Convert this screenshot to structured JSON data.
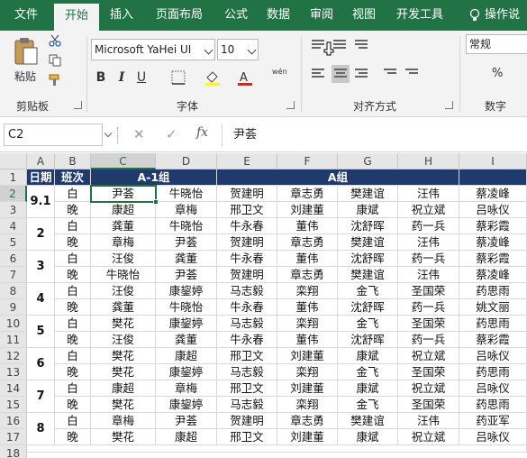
{
  "ribbon_tabs": [
    "文件",
    "开始",
    "插入",
    "页面布局",
    "公式",
    "数据",
    "审阅",
    "视图",
    "开发工具",
    "操作说"
  ],
  "active_tab": "开始",
  "clipboard": {
    "paste_label": "粘贴",
    "group_label": "剪贴板"
  },
  "font": {
    "name": "Microsoft YaHei UI",
    "size": "10",
    "group_label": "字体",
    "bold": "B",
    "italic": "I",
    "underline": "U",
    "phonetic_label": "wén"
  },
  "alignment": {
    "group_label": "对齐方式"
  },
  "number": {
    "format": "常规",
    "group_label": "数字",
    "percent": "%"
  },
  "formula_bar": {
    "name_box": "C2",
    "cancel": "✕",
    "confirm": "✓",
    "fx": "fx",
    "value": "尹荟"
  },
  "columns": [
    "A",
    "B",
    "C",
    "D",
    "E",
    "F",
    "G",
    "H",
    "I"
  ],
  "selected_column": "C",
  "rows": [
    "1",
    "2",
    "3",
    "4",
    "5",
    "6",
    "7",
    "8",
    "9",
    "10",
    "11",
    "12",
    "13",
    "14",
    "15",
    "16",
    "17",
    "18"
  ],
  "selected_row": "2",
  "header": {
    "date": "日期",
    "shift": "班次",
    "group_a1": "A-1组",
    "group_a": "A组"
  },
  "date_labels": [
    "9.1",
    "2",
    "3",
    "4",
    "5",
    "6",
    "7",
    "8"
  ],
  "table_rows": [
    [
      "白",
      "尹荟",
      "牛晓怡",
      "贺建明",
      "章志勇",
      "樊建谊",
      "汪伟",
      "蔡凌峰"
    ],
    [
      "晚",
      "康超",
      "章梅",
      "邢卫文",
      "刘建董",
      "康斌",
      "祝立斌",
      "吕咏仪"
    ],
    [
      "白",
      "龚董",
      "牛晓怡",
      "牛永春",
      "董伟",
      "沈舒晖",
      "药一兵",
      "蔡彩霞"
    ],
    [
      "晚",
      "章梅",
      "尹荟",
      "贺建明",
      "章志勇",
      "樊建谊",
      "汪伟",
      "蔡凌峰"
    ],
    [
      "白",
      "汪俊",
      "龚董",
      "牛永春",
      "董伟",
      "沈舒晖",
      "药一兵",
      "蔡彩霞"
    ],
    [
      "晚",
      "牛晓怡",
      "尹荟",
      "贺建明",
      "章志勇",
      "樊建谊",
      "汪伟",
      "蔡凌峰"
    ],
    [
      "白",
      "汪俊",
      "康鋆婷",
      "马志毅",
      "栾翔",
      "金飞",
      "圣国荣",
      "药思雨"
    ],
    [
      "晚",
      "龚董",
      "牛晓怡",
      "牛永春",
      "董伟",
      "沈舒晖",
      "药一兵",
      "姚文丽"
    ],
    [
      "白",
      "樊花",
      "康鋆婷",
      "马志毅",
      "栾翔",
      "金飞",
      "圣国荣",
      "药思雨"
    ],
    [
      "晚",
      "汪俊",
      "龚董",
      "牛永春",
      "董伟",
      "沈舒晖",
      "药一兵",
      "蔡彩霞"
    ],
    [
      "白",
      "樊花",
      "康超",
      "邢卫文",
      "刘建董",
      "康斌",
      "祝立斌",
      "吕咏仪"
    ],
    [
      "晚",
      "樊花",
      "康鋆婷",
      "马志毅",
      "栾翔",
      "金飞",
      "圣国荣",
      "药思雨"
    ],
    [
      "白",
      "康超",
      "章梅",
      "邢卫文",
      "刘建董",
      "康斌",
      "祝立斌",
      "吕咏仪"
    ],
    [
      "晚",
      "樊花",
      "康鋆婷",
      "马志毅",
      "栾翔",
      "金飞",
      "圣国荣",
      "药思雨"
    ],
    [
      "白",
      "章梅",
      "尹荟",
      "贺建明",
      "章志勇",
      "樊建谊",
      "汪伟",
      "药亚军"
    ],
    [
      "晚",
      "樊花",
      "康超",
      "邢卫文",
      "刘建董",
      "康斌",
      "祝立斌",
      "吕咏仪"
    ]
  ],
  "colors": {
    "ribbon_green": "#217346",
    "header_navy": "#1f3b6e"
  },
  "icons": [
    "cut-icon",
    "copy-icon",
    "format-painter-icon",
    "borders-icon",
    "fill-color-icon",
    "font-color-icon",
    "align-icons",
    "help-bulb-icon",
    "pointer-cursor-icon"
  ]
}
